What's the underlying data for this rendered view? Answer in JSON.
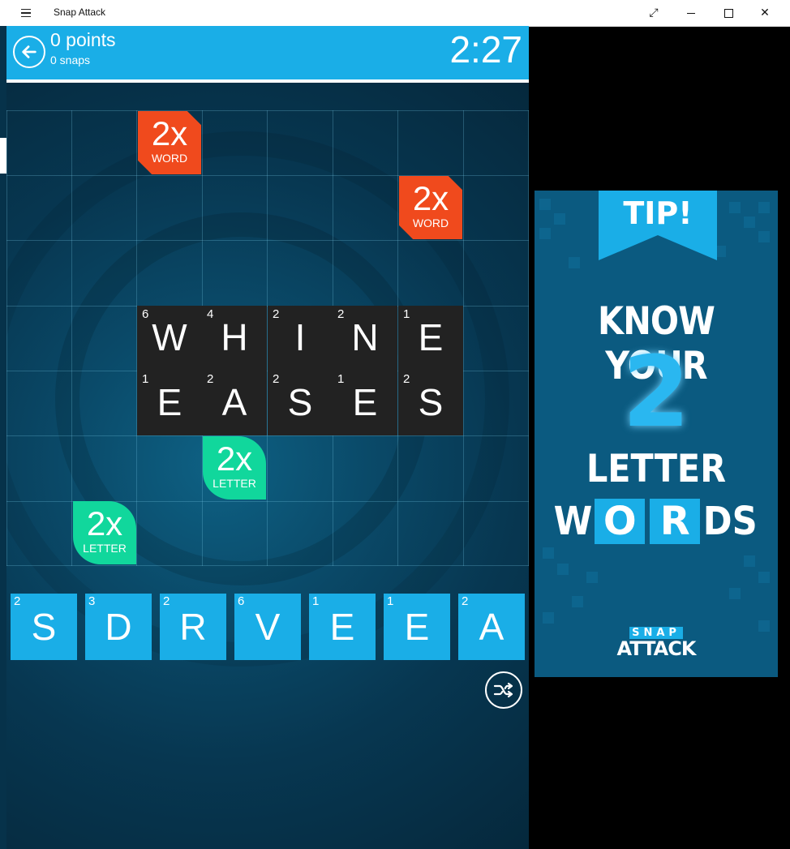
{
  "window": {
    "title": "Snap Attack",
    "minimize_glyph": "",
    "close_glyph": "✕",
    "fullscreen_glyph": "⤢"
  },
  "header": {
    "points": "0 points",
    "snaps": "0 snaps",
    "timer": "2:27"
  },
  "board": {
    "placed_rows": [
      {
        "tiles": [
          {
            "letter": "W",
            "value": "6"
          },
          {
            "letter": "H",
            "value": "4"
          },
          {
            "letter": "I",
            "value": "2"
          },
          {
            "letter": "N",
            "value": "2"
          },
          {
            "letter": "E",
            "value": "1"
          }
        ]
      },
      {
        "tiles": [
          {
            "letter": "E",
            "value": "1"
          },
          {
            "letter": "A",
            "value": "2"
          },
          {
            "letter": "S",
            "value": "2"
          },
          {
            "letter": "E",
            "value": "1"
          },
          {
            "letter": "S",
            "value": "2"
          }
        ]
      }
    ],
    "bonuses": [
      {
        "type": "word",
        "multiplier": "2x",
        "label": "WORD"
      },
      {
        "type": "word",
        "multiplier": "2x",
        "label": "WORD"
      },
      {
        "type": "letter",
        "multiplier": "2x",
        "label": "LETTER"
      },
      {
        "type": "letter",
        "multiplier": "2x",
        "label": "LETTER"
      }
    ],
    "colors": {
      "word_bonus": "#f04a1d",
      "letter_bonus": "#11d79c",
      "tile_dark": "#222222",
      "accent": "#1aaee7"
    }
  },
  "rack": [
    {
      "letter": "S",
      "value": "2"
    },
    {
      "letter": "D",
      "value": "3"
    },
    {
      "letter": "R",
      "value": "2"
    },
    {
      "letter": "V",
      "value": "6"
    },
    {
      "letter": "E",
      "value": "1"
    },
    {
      "letter": "E",
      "value": "1"
    },
    {
      "letter": "A",
      "value": "2"
    }
  ],
  "ad": {
    "ribbon": "TIP!",
    "line1": "KNOW YOUR",
    "number": "2",
    "line2": "LETTER",
    "line3_a": "W",
    "line3_b": "O",
    "line3_c": "R",
    "line3_d": "DS",
    "logo_top": "SNAP",
    "logo_bottom": "ATTACK"
  },
  "icons": {
    "back": "arrow-left-circle-icon",
    "shuffle": "shuffle-icon",
    "menu": "hamburger-icon"
  }
}
